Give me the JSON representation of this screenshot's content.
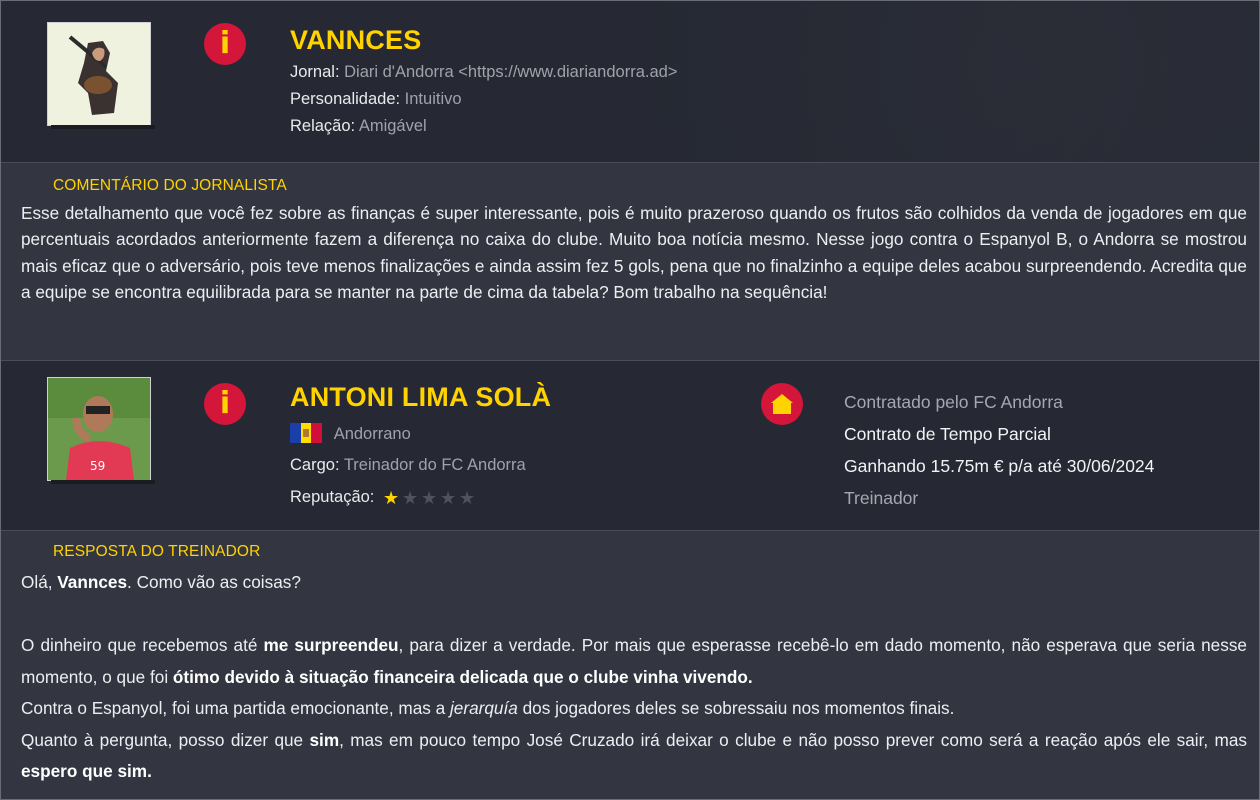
{
  "journalist": {
    "name": "VANNCES",
    "fields": [
      {
        "label": "Jornal:",
        "value": "Diari d'Andorra <https://www.diariandorra.ad>"
      },
      {
        "label": "Personalidade:",
        "value": "Intuitivo"
      },
      {
        "label": "Relação:",
        "value": "Amigável"
      }
    ],
    "comment_title": "COMENTÁRIO DO JORNALISTA",
    "comment": "Esse detalhamento que você fez sobre as finanças é super interessante, pois é muito prazeroso quando os frutos são colhidos da venda de jogadores em que percentuais acordados anteriormente fazem a diferença no caixa do clube. Muito boa notícia mesmo. Nesse jogo contra o Espanyol B, o Andorra se mostrou mais eficaz que o adversário, pois teve menos finalizações e ainda assim fez 5 gols, pena que no finalzinho a equipe deles acabou surpreendendo. Acredita que a equipe se encontra equilibrada para se manter na parte de cima da tabela? Bom trabalho na sequência!"
  },
  "manager": {
    "name": "ANTONI LIMA SOLÀ",
    "nationality": "Andorrano",
    "role_label": "Cargo:",
    "role_value": "Treinador do FC Andorra",
    "reputation_label": "Reputação:",
    "reputation_stars": 1,
    "reputation_max": 5,
    "contract": {
      "hired_by": "Contratado pelo FC Andorra",
      "type": "Contrato de Tempo Parcial",
      "salary": "Ganhando 15.75m € p/a até 30/06/2024",
      "position": "Treinador"
    },
    "reply_title": "RESPOSTA DO TREINADOR",
    "reply": {
      "greeting_a": "Olá, ",
      "greeting_b": "Vannces",
      "greeting_c": ". Como vão as coisas?",
      "p2_a": "O dinheiro que recebemos até ",
      "p2_b": "me surpreendeu",
      "p2_c": ", para dizer a verdade. Por mais que esperasse recebê-lo em dado momento, não esperava que seria nesse momento, o que foi ",
      "p2_d": "ótimo devido à situação financeira delicada que o clube vinha vivendo.",
      "p3_a": "Contra o Espanyol, foi uma partida emocionante, mas a ",
      "p3_b": "jerarquía",
      "p3_c": " dos jogadores deles se sobressaiu nos momentos finais.",
      "p4_a": "Quanto à pergunta, posso dizer que ",
      "p4_b": "sim",
      "p4_c": ", mas em pouco tempo José Cruzado irá deixar o clube e não posso prever como será a reação após ele sair, mas ",
      "p4_d": "espero que sim."
    }
  },
  "icons": {
    "info": "info-icon",
    "home": "home-icon",
    "star": "star-icon",
    "flag": "andorra-flag-icon"
  },
  "colors": {
    "accent_yellow": "#ffd200",
    "badge_red": "#d3163a"
  }
}
